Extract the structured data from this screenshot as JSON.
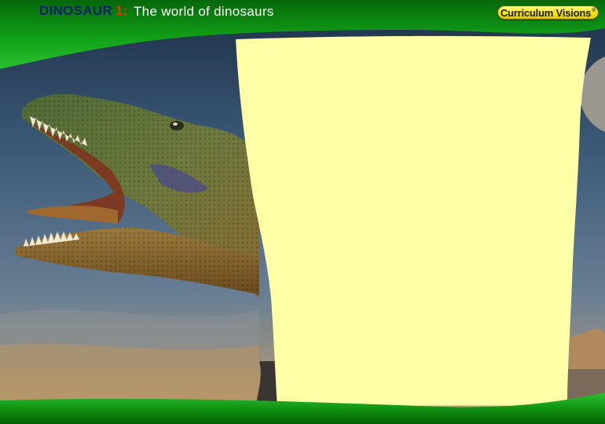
{
  "header": {
    "subject": "DINOSAUR",
    "unit_number": "1:",
    "title": "The world of dinosaurs"
  },
  "brand": {
    "logo_text": "Curriculum Visions",
    "logo_mark": "®"
  },
  "content_panel": {
    "text": ""
  },
  "colors": {
    "header_green": "#0c8a10",
    "panel_cream": "#ffffa8",
    "subject_blue": "#10206a",
    "number_red": "#d23a08",
    "logo_yellow": "#f5e800"
  }
}
